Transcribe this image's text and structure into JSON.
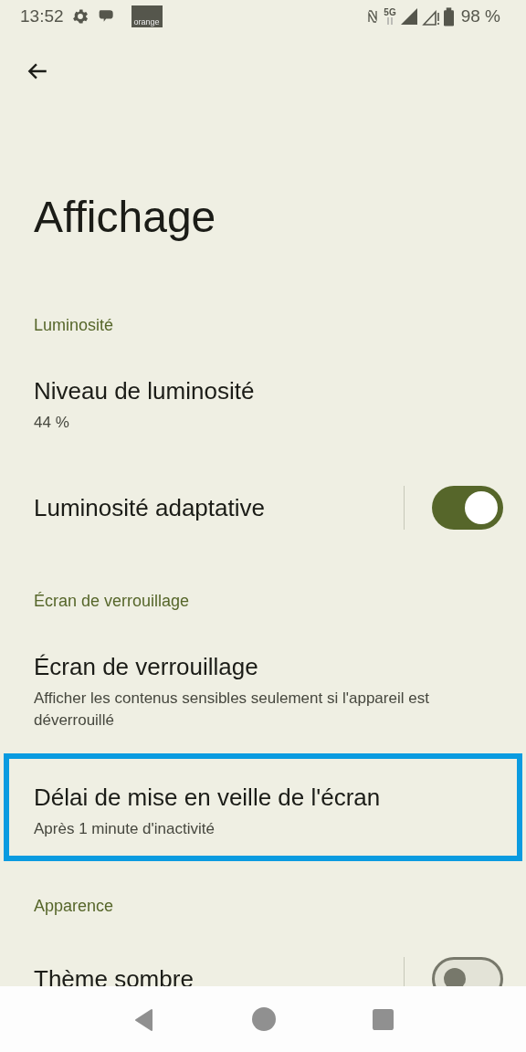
{
  "status_bar": {
    "time": "13:52",
    "logo_text": "orange",
    "network": "5G",
    "battery": "98 %"
  },
  "title": "Affichage",
  "sections": [
    {
      "header": "Luminosité",
      "items": [
        {
          "kind": "text",
          "title": "Niveau de luminosité",
          "subtitle": "44 %",
          "selected": false
        },
        {
          "kind": "toggle",
          "title": "Luminosité adaptative",
          "on": true,
          "selected": false
        }
      ]
    },
    {
      "header": "Écran de verrouillage",
      "items": [
        {
          "kind": "text",
          "title": "Écran de verrouillage",
          "subtitle": "Afficher les contenus sensibles seulement si l'appareil est déverrouillé",
          "selected": false
        },
        {
          "kind": "text",
          "title": "Délai de mise en veille de l'écran",
          "subtitle": "Après 1 minute d'inactivité",
          "selected": true
        }
      ]
    },
    {
      "header": "Apparence",
      "items": [
        {
          "kind": "toggle",
          "title": "Thème sombre",
          "on": false,
          "selected": false
        }
      ]
    }
  ]
}
